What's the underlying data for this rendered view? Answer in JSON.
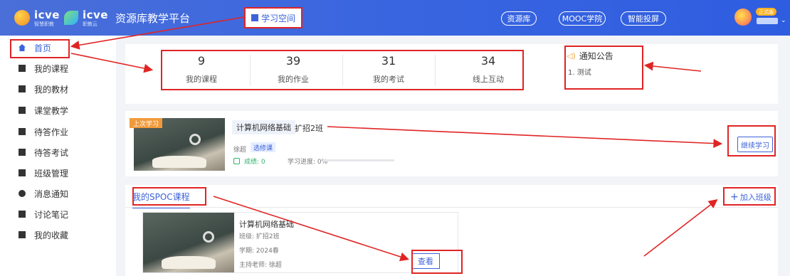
{
  "header": {
    "logo_icve": "icve",
    "logo_icve_sub": "智慧职教",
    "logo_icve2": "icve",
    "logo_icve2_sub": "职教云",
    "platform_title": "资源库教学平台",
    "study_space": "学习空间",
    "pills": [
      "资源库",
      "MOOC学院",
      "智能投屏"
    ],
    "vip_badge": "正式版"
  },
  "sidebar": {
    "items": [
      {
        "label": "首页",
        "icon": "home-icon",
        "active": true
      },
      {
        "label": "我的课程",
        "icon": "books-icon"
      },
      {
        "label": "我的教材",
        "icon": "textbook-icon"
      },
      {
        "label": "课堂教学",
        "icon": "classroom-icon"
      },
      {
        "label": "待答作业",
        "icon": "homework-icon"
      },
      {
        "label": "待答考试",
        "icon": "exam-icon"
      },
      {
        "label": "班级管理",
        "icon": "class-icon"
      },
      {
        "label": "消息通知",
        "icon": "message-icon"
      },
      {
        "label": "讨论笔记",
        "icon": "notes-icon"
      },
      {
        "label": "我的收藏",
        "icon": "folder-icon"
      }
    ]
  },
  "stats": [
    {
      "value": "9",
      "label": "我的课程"
    },
    {
      "value": "39",
      "label": "我的作业"
    },
    {
      "value": "31",
      "label": "我的考试"
    },
    {
      "value": "34",
      "label": "线上互动"
    }
  ],
  "notice": {
    "title": "通知公告",
    "items": [
      "1. 测试"
    ]
  },
  "last_study": {
    "tag": "上次学习",
    "course_name": "计算机网络基础",
    "class_name": "扩招2班",
    "teacher": "徐超",
    "type": "选修课",
    "score_label": "成绩: 0",
    "progress_label": "学习进度: 0%",
    "progress": 0,
    "continue_label": "继续学习"
  },
  "spoc": {
    "tab_label": "我的SPOC课程",
    "join_label": "加入班级",
    "course": {
      "name": "计算机网络基础",
      "class": "班级: 扩招2班",
      "term": "学期: 2024春",
      "teacher": "主持老师: 徐超",
      "view_label": "查看"
    }
  },
  "colors": {
    "accent": "#3c63d9",
    "annotation": "#e02424",
    "tag_orange": "#f29a3b"
  }
}
